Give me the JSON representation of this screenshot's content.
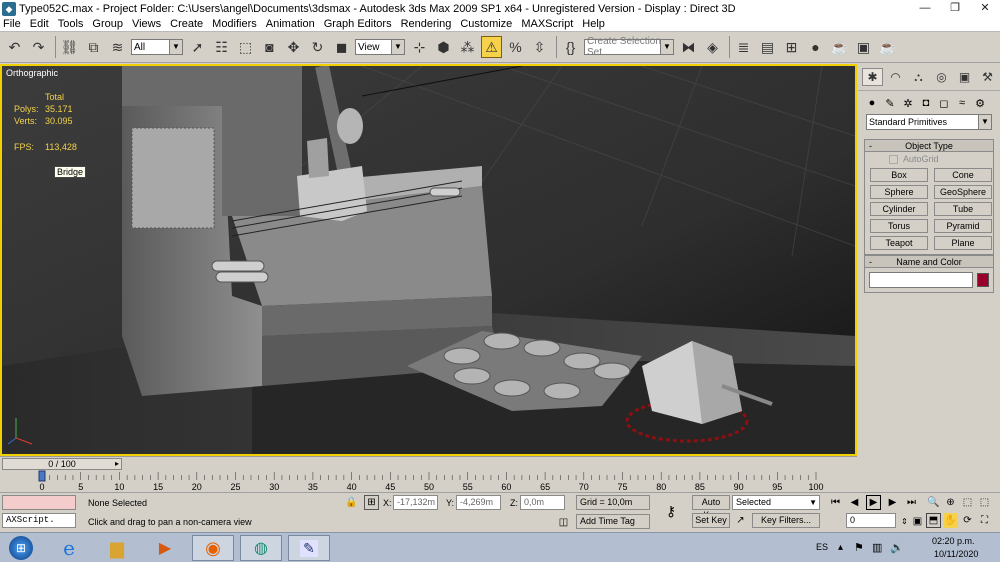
{
  "titlebar": {
    "title": "Type052C.max      - Project Folder: C:\\Users\\angel\\Documents\\3dsmax      - Autodesk 3ds Max  2009 SP1  x64   - Unregistered Version      - Display : Direct 3D",
    "minimize": "—",
    "maximize": "❐",
    "close": "✕"
  },
  "menu": [
    "File",
    "Edit",
    "Tools",
    "Group",
    "Views",
    "Create",
    "Modifiers",
    "Animation",
    "Graph Editors",
    "Rendering",
    "Customize",
    "MAXScript",
    "Help"
  ],
  "toolbar": {
    "filter_select": "All",
    "coord_select": "View",
    "selection_set": "Create Selection Set"
  },
  "viewport": {
    "label": "Orthographic",
    "stats": {
      "total_label": "Total",
      "polys_label": "Polys:",
      "polys_value": "35.171",
      "verts_label": "Verts:",
      "verts_value": "30.095",
      "fps_label": "FPS:",
      "fps_value": "113,428"
    },
    "tooltip": "Bridge"
  },
  "command_panel": {
    "category": "Standard Primitives",
    "object_type_title": "Object Type",
    "autogrid_label": "AutoGrid",
    "primitives": [
      "Box",
      "Cone",
      "Sphere",
      "GeoSphere",
      "Cylinder",
      "Tube",
      "Torus",
      "Pyramid",
      "Teapot",
      "Plane"
    ],
    "name_color_title": "Name and Color",
    "color": "#99002a"
  },
  "timeline": {
    "frame_display": "0 / 100",
    "ticks": [
      0,
      5,
      10,
      15,
      20,
      25,
      30,
      35,
      40,
      45,
      50,
      55,
      60,
      65,
      70,
      75,
      80,
      85,
      90,
      95,
      100
    ]
  },
  "status": {
    "maxscript_label": "AXScript.",
    "selection": "None Selected",
    "prompt": "Click and drag to pan a non-camera view",
    "x_label": "X:",
    "x_value": "-17,132m",
    "y_label": "Y:",
    "y_value": "-4,269m",
    "z_label": "Z:",
    "z_value": "0,0m",
    "grid": "Grid = 10,0m",
    "add_time_tag": "Add Time Tag",
    "auto_key": "Auto Key",
    "set_key": "Set Key",
    "key_mode": "Selected",
    "key_filters": "Key Filters...",
    "frame_value": "0"
  },
  "taskbar": {
    "language": "ES",
    "time": "02:20 p.m.",
    "date": "10/11/2020"
  }
}
